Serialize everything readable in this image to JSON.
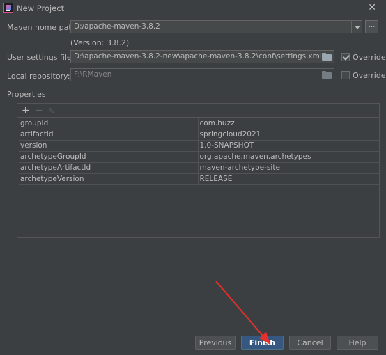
{
  "window": {
    "title": "New Project",
    "close_icon": "close-icon"
  },
  "maven_home": {
    "label": "Maven home path:",
    "value": "D:/apache-maven-3.8.2",
    "version_note": "(Version: 3.8.2)",
    "browse_label": "..."
  },
  "user_settings": {
    "label": "User settings file:",
    "value": "D:\\apache-maven-3.8.2-new\\apache-maven-3.8.2\\conf\\settings.xml",
    "override_label": "Override",
    "override_checked": true
  },
  "local_repo": {
    "label": "Local repository:",
    "value": "F:\\RMaven",
    "override_label": "Override",
    "override_checked": false
  },
  "properties": {
    "section_label": "Properties",
    "toolbar": {
      "add": "+",
      "remove": "−",
      "edit": "✎"
    },
    "rows": [
      {
        "key": "groupId",
        "value": "com.huzz"
      },
      {
        "key": "artifactId",
        "value": "springcloud2021"
      },
      {
        "key": "version",
        "value": "1.0-SNAPSHOT"
      },
      {
        "key": "archetypeGroupId",
        "value": "org.apache.maven.archetypes"
      },
      {
        "key": "archetypeArtifactId",
        "value": "maven-archetype-site"
      },
      {
        "key": "archetypeVersion",
        "value": "RELEASE"
      }
    ]
  },
  "buttons": {
    "previous": "Previous",
    "finish": "Finish",
    "cancel": "Cancel",
    "help": "Help"
  },
  "colors": {
    "background": "#3c3f41",
    "primary_button": "#365880",
    "annotation_arrow": "#e8302c"
  }
}
